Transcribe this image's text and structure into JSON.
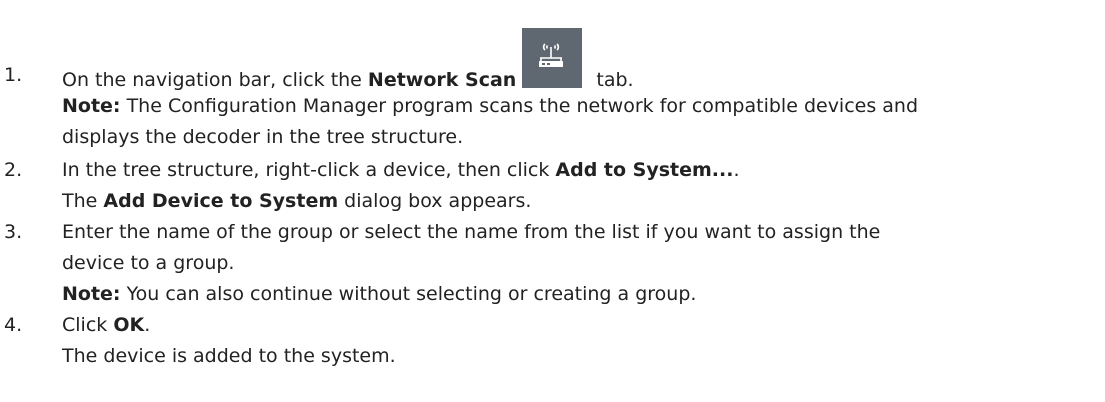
{
  "steps": [
    {
      "number": "1.",
      "line1": {
        "prefix": "On the navigation bar, click the ",
        "bold": "Network Scan",
        "suffix": " tab."
      },
      "note_label": "Note:",
      "note_line1": " The Configuration Manager program scans the network for compatible devices and",
      "note_line2": "displays the decoder in the tree structure.",
      "icon": "network-scan-icon"
    },
    {
      "number": "2.",
      "line1": {
        "prefix": "In the tree structure, right-click a device, then click ",
        "bold": "Add to System...",
        "suffix": "."
      },
      "line2": {
        "prefix": "The ",
        "bold": "Add Device to System",
        "suffix": " dialog box appears."
      }
    },
    {
      "number": "3.",
      "line1": "Enter the name of the group or select the name from the list if you want to assign the",
      "line2": "device to a group.",
      "note_label": "Note:",
      "note_text": " You can also continue without selecting or creating a group."
    },
    {
      "number": "4.",
      "line1": {
        "prefix": "Click ",
        "bold": "OK",
        "suffix": "."
      },
      "line2": "The device is added to the system."
    }
  ],
  "colors": {
    "text": "#222222",
    "icon_bg": "#5f6871",
    "icon_fg": "#ffffff"
  }
}
